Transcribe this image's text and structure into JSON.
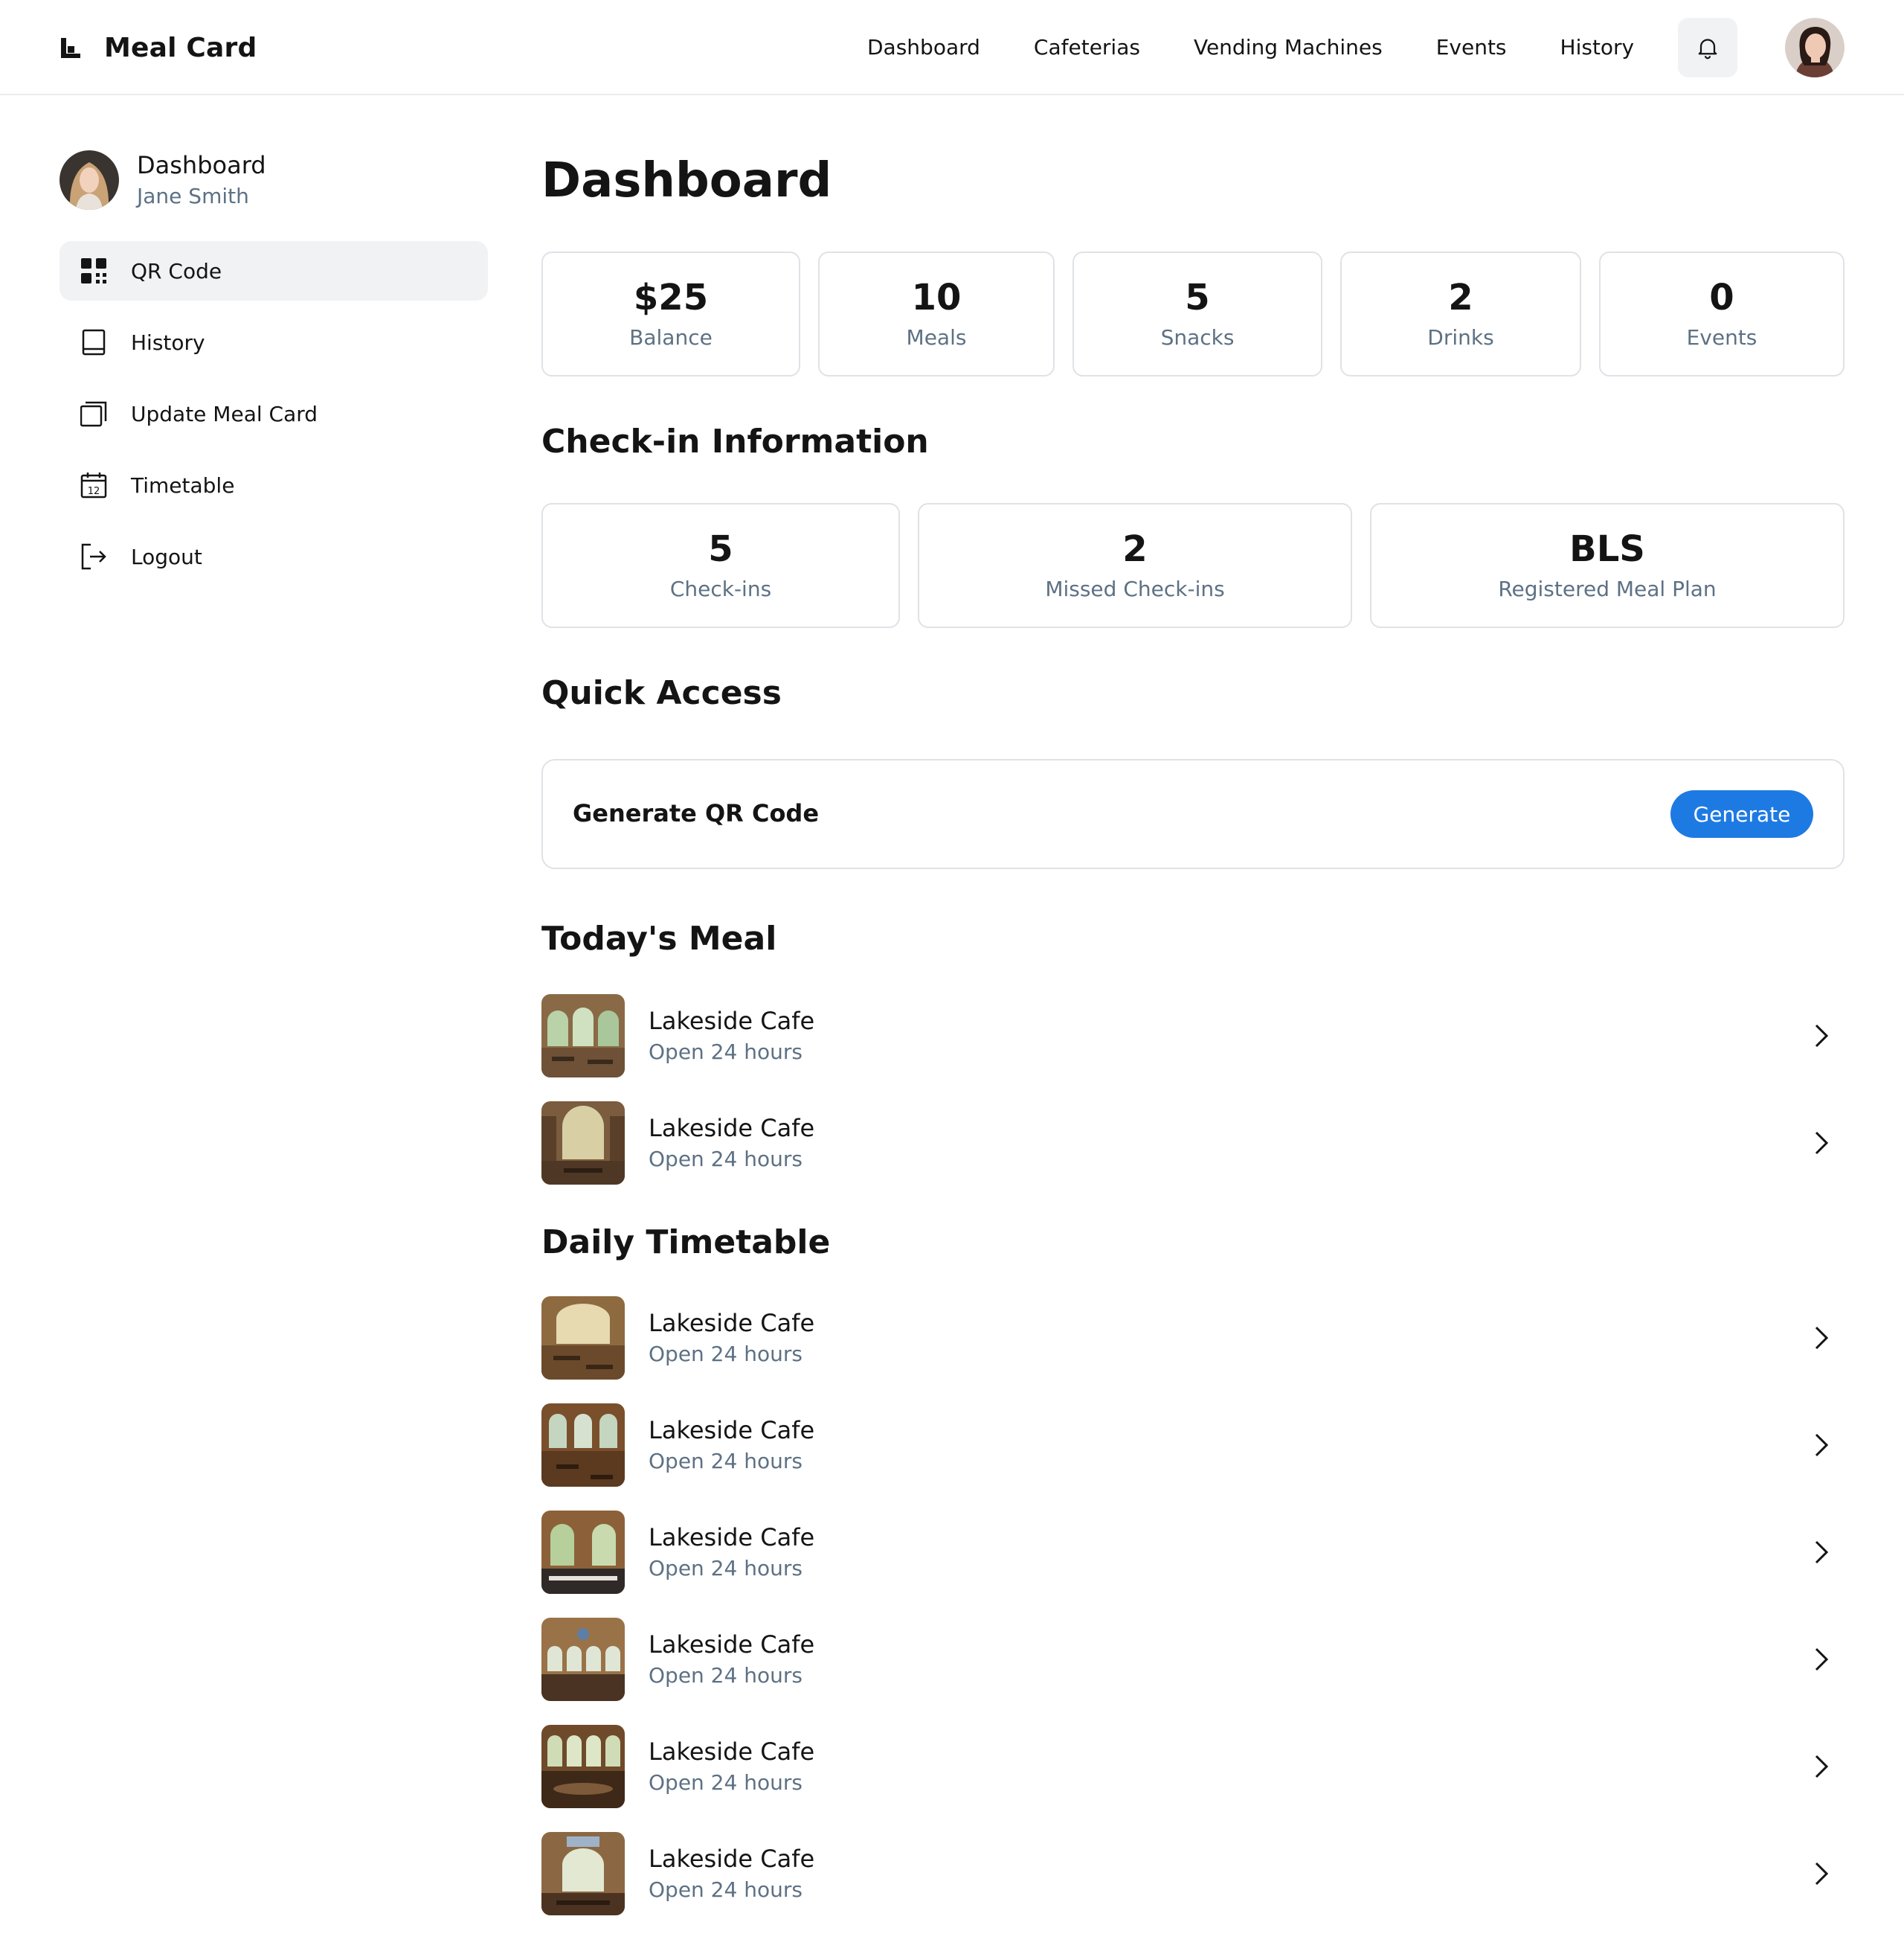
{
  "app": {
    "title": "Meal Card"
  },
  "topnav": [
    "Dashboard",
    "Cafeterias",
    "Vending Machines",
    "Events",
    "History"
  ],
  "sidebar": {
    "profile_title": "Dashboard",
    "profile_name": "Jane Smith",
    "items": [
      {
        "label": "QR Code",
        "icon": "qr-code-icon",
        "active": true
      },
      {
        "label": "History",
        "icon": "book-icon"
      },
      {
        "label": "Update Meal Card",
        "icon": "cards-icon"
      },
      {
        "label": "Timetable",
        "icon": "calendar-icon",
        "icon_text": "12"
      },
      {
        "label": "Logout",
        "icon": "logout-icon"
      }
    ]
  },
  "main": {
    "title": "Dashboard",
    "stats": [
      {
        "value": "$25",
        "label": "Balance"
      },
      {
        "value": "10",
        "label": "Meals"
      },
      {
        "value": "5",
        "label": "Snacks"
      },
      {
        "value": "2",
        "label": "Drinks"
      },
      {
        "value": "0",
        "label": "Events"
      }
    ],
    "checkin_title": "Check-in Information",
    "checkins": [
      {
        "value": "5",
        "label": "Check-ins"
      },
      {
        "value": "2",
        "label": "Missed Check-ins"
      },
      {
        "value": "BLS",
        "label": "Registered Meal Plan"
      }
    ],
    "quick_access_title": "Quick Access",
    "quick_access": {
      "label": "Generate QR Code",
      "button": "Generate"
    },
    "todays_meal_title": "Today's Meal",
    "todays_meal": [
      {
        "title": "Lakeside Cafe",
        "subtitle": "Open 24 hours"
      },
      {
        "title": "Lakeside Cafe",
        "subtitle": "Open 24 hours"
      }
    ],
    "timetable_title": "Daily Timetable",
    "timetable": [
      {
        "title": "Lakeside Cafe",
        "subtitle": "Open 24 hours"
      },
      {
        "title": "Lakeside Cafe",
        "subtitle": "Open 24 hours"
      },
      {
        "title": "Lakeside Cafe",
        "subtitle": "Open 24 hours"
      },
      {
        "title": "Lakeside Cafe",
        "subtitle": "Open 24 hours"
      },
      {
        "title": "Lakeside Cafe",
        "subtitle": "Open 24 hours"
      },
      {
        "title": "Lakeside Cafe",
        "subtitle": "Open 24 hours"
      }
    ]
  },
  "colors": {
    "accent": "#1e7ae3",
    "muted_text": "#5d7184",
    "border": "#dfe2e6",
    "active_bg": "#f1f2f3"
  }
}
